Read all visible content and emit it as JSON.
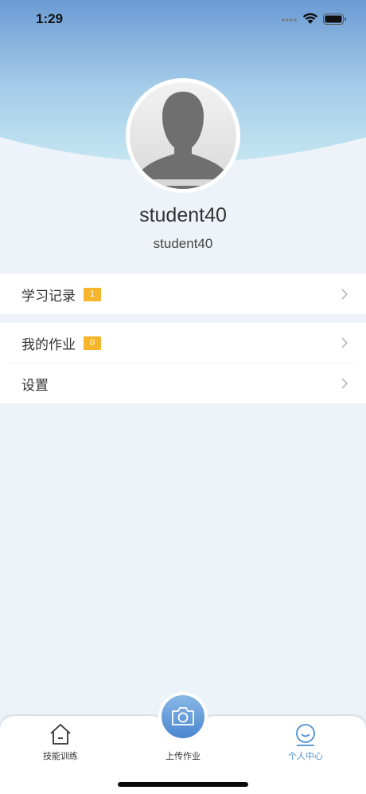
{
  "status_bar": {
    "time": "1:29"
  },
  "profile": {
    "name": "student40",
    "account": "student40"
  },
  "menu": {
    "study_records": {
      "label": "学习记录",
      "badge": "1"
    },
    "my_homework": {
      "label": "我的作业",
      "badge": "0"
    },
    "settings": {
      "label": "设置"
    }
  },
  "tabbar": {
    "skills": {
      "label": "技能训练",
      "icon": "home-icon"
    },
    "upload": {
      "label": "上传作业",
      "icon": "camera-icon"
    },
    "profile": {
      "label": "个人中心",
      "icon": "smile-icon"
    }
  },
  "colors": {
    "accent": "#4a90d0",
    "badge": "#f6b52a",
    "background": "#edf3f8",
    "header_top": "#6f9fd6",
    "header_bottom": "#bfe1ef"
  }
}
